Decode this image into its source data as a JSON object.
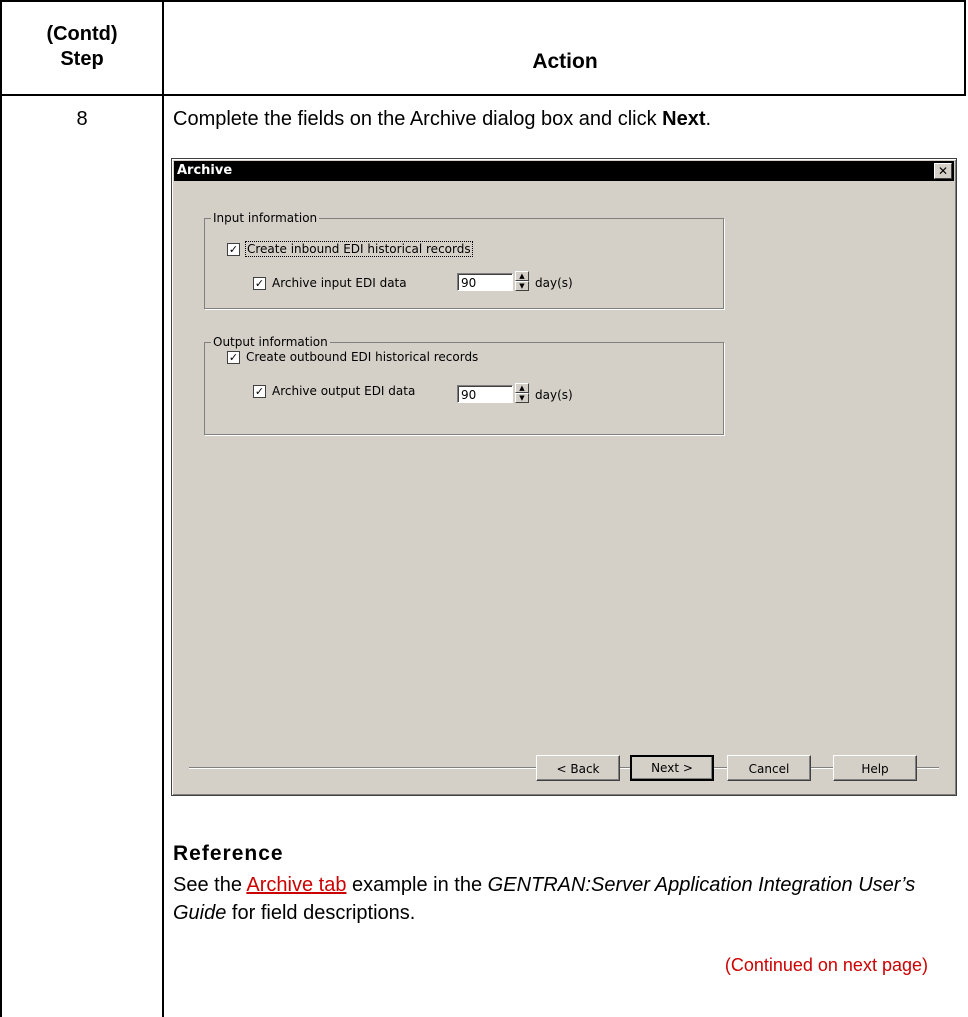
{
  "table": {
    "step_header_line1": "(Contd)",
    "step_header_line2": "Step",
    "action_header": "Action"
  },
  "step": {
    "number": "8",
    "instruction_prefix": "Complete the fields on the Archive dialog box and click ",
    "instruction_bold": "Next",
    "instruction_suffix": "."
  },
  "dialog": {
    "title": "Archive",
    "close_symbol": "✕",
    "input_group": {
      "legend": "Input information",
      "create_label": "Create inbound EDI historical records",
      "create_checked": true,
      "archive_label": "Archive input EDI data",
      "archive_checked": true,
      "days_value": "90",
      "unit": "day(s)"
    },
    "output_group": {
      "legend": "Output information",
      "create_label": "Create outbound EDI historical records",
      "create_checked": true,
      "archive_label": "Archive output EDI data",
      "archive_checked": true,
      "days_value": "90",
      "unit": "day(s)"
    },
    "buttons": {
      "back": "< Back",
      "next": "Next >",
      "cancel": "Cancel",
      "help": "Help"
    }
  },
  "reference": {
    "title": "Reference",
    "text_prefix": "See the ",
    "link_text": "Archive tab",
    "text_middle": " example in the ",
    "guide_title": "GENTRAN:Server Application Integration User’s Guide",
    "text_suffix": " for field descriptions.",
    "continued": "(Continued on next page)"
  },
  "colors": {
    "link": "#cc0000",
    "dialog_bg": "#d4d0c8",
    "titlebar": "#000000"
  }
}
